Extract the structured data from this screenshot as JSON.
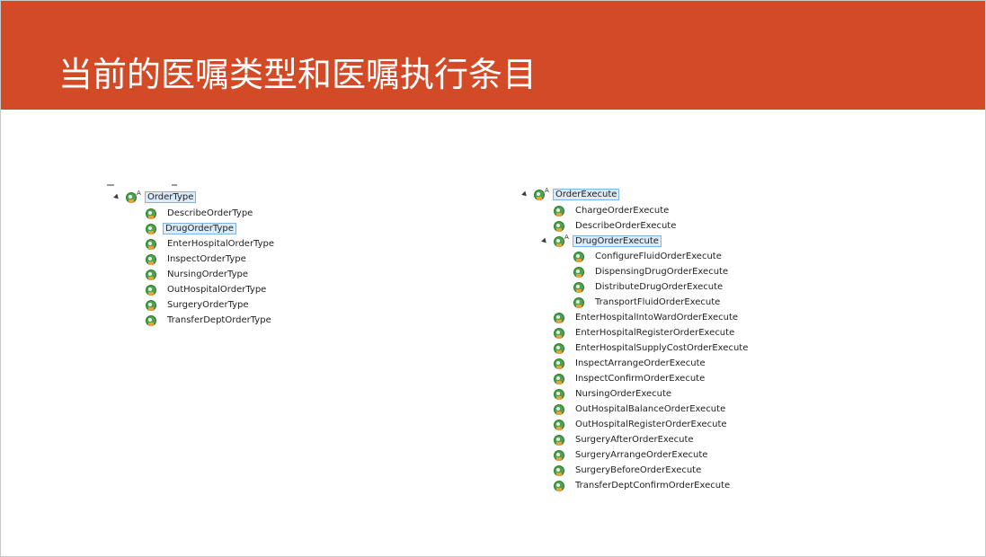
{
  "slide": {
    "title": "当前的医嘱类型和医嘱执行条目",
    "accent_color": "#d24a26"
  },
  "left_tree": {
    "root": "OrderType",
    "children": [
      "DescribeOrderType",
      "DrugOrderType",
      "EnterHospitalOrderType",
      "InspectOrderType",
      "NursingOrderType",
      "OutHospitalOrderType",
      "SurgeryOrderType",
      "TransferDeptOrderType"
    ],
    "selected_child": "DrugOrderType"
  },
  "right_tree": {
    "root": "OrderExecute",
    "children": [
      "ChargeOrderExecute",
      "DescribeOrderExecute",
      "DrugOrderExecute",
      "EnterHospitalIntoWardOrderExecute",
      "EnterHospitalRegisterOrderExecute",
      "EnterHospitalSupplyCostOrderExecute",
      "InspectArrangeOrderExecute",
      "InspectConfirmOrderExecute",
      "NursingOrderExecute",
      "OutHospitalBalanceOrderExecute",
      "OutHospitalRegisterOrderExecute",
      "SurgeryAfterOrderExecute",
      "SurgeryArrangeOrderExecute",
      "SurgeryBeforeOrderExecute",
      "TransferDeptConfirmOrderExecute"
    ],
    "drug_children": [
      "ConfigureFluidOrderExecute",
      "DispensingDrugOrderExecute",
      "DistributeDrugOrderExecute",
      "TransportFluidOrderExecute"
    ]
  },
  "icons": {
    "class": "class-icon",
    "abstract_class": "abstract-class-icon",
    "expander": "tree-expand-arrow-icon"
  }
}
